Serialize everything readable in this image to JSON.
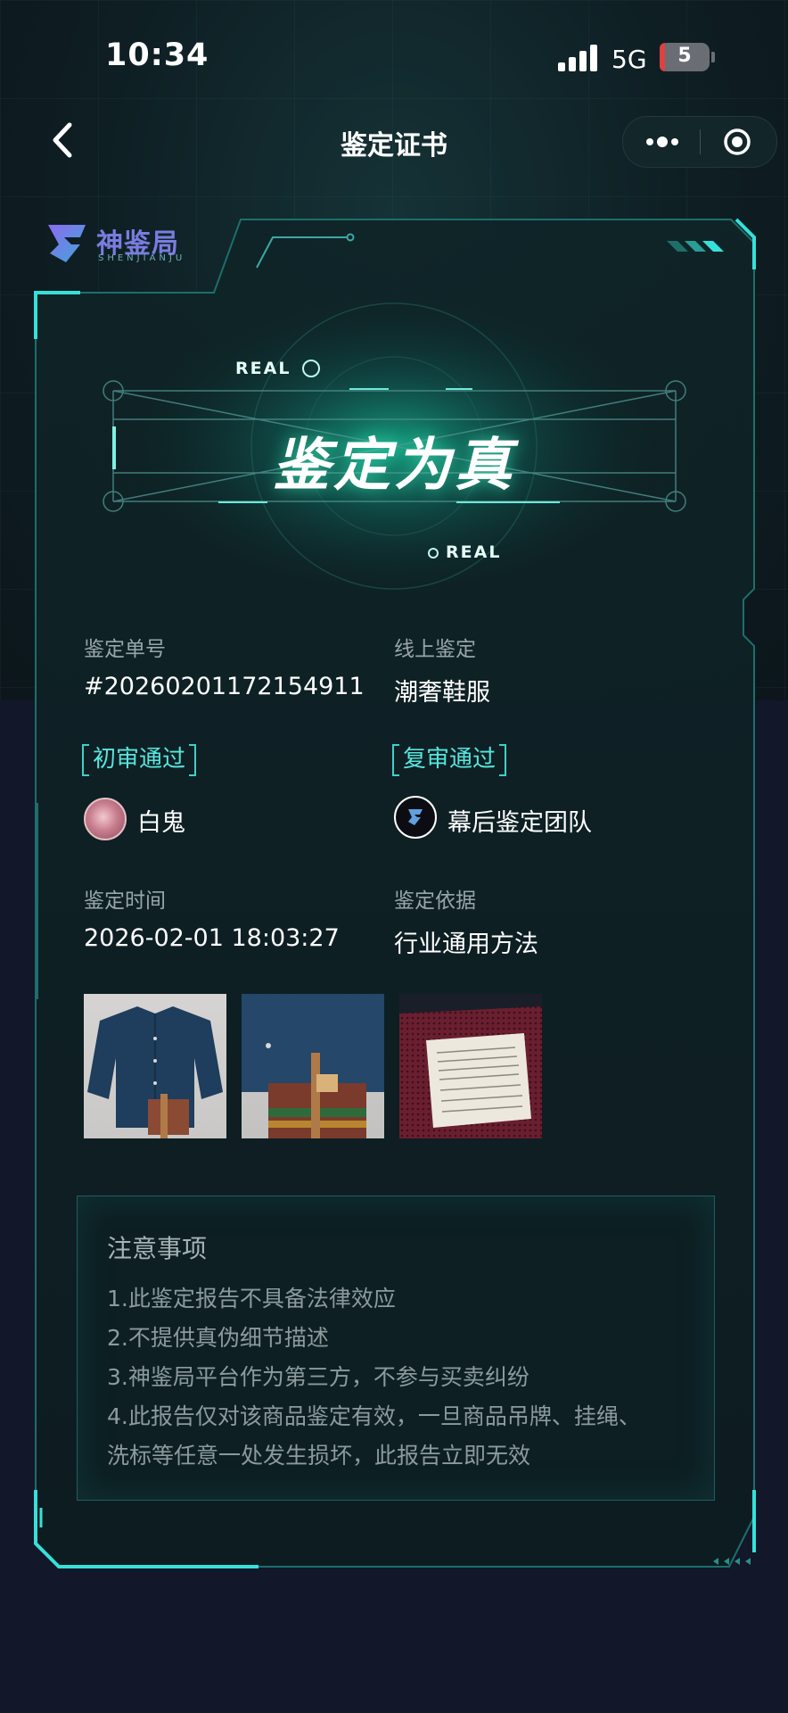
{
  "status_bar": {
    "time": "10:34",
    "network": "5G",
    "battery": "5"
  },
  "nav": {
    "title": "鉴定证书"
  },
  "brand": {
    "name": "神鉴局",
    "pinyin": "SHENJIANJU"
  },
  "hero": {
    "result": "鉴定为真",
    "badge_top": "REAL",
    "badge_bottom": "REAL"
  },
  "details": {
    "order_label": "鉴定单号",
    "order_value": "#20260201172154911",
    "mode_label": "线上鉴定",
    "mode_value": "潮奢鞋服",
    "first_review_tag": "初审通过",
    "first_reviewer": "白鬼",
    "second_review_tag": "复审通过",
    "second_reviewer": "幕后鉴定团队",
    "time_label": "鉴定时间",
    "time_value": "2026-02-01 18:03:27",
    "basis_label": "鉴定依据",
    "basis_value": "行业通用方法"
  },
  "notice": {
    "title": "注意事项",
    "lines": [
      "1.此鉴定报告不具备法律效应",
      "2.不提供真伪细节描述",
      "3.神鉴局平台作为第三方，不参与买卖纠纷",
      "4.此报告仅对该商品鉴定有效，一旦商品吊牌、挂绳、",
      "洗标等任意一处发生损坏，此报告立即无效"
    ]
  },
  "colors": {
    "accent": "#3fd0ca",
    "glow": "#1fe0b0",
    "background": "#12172a"
  }
}
